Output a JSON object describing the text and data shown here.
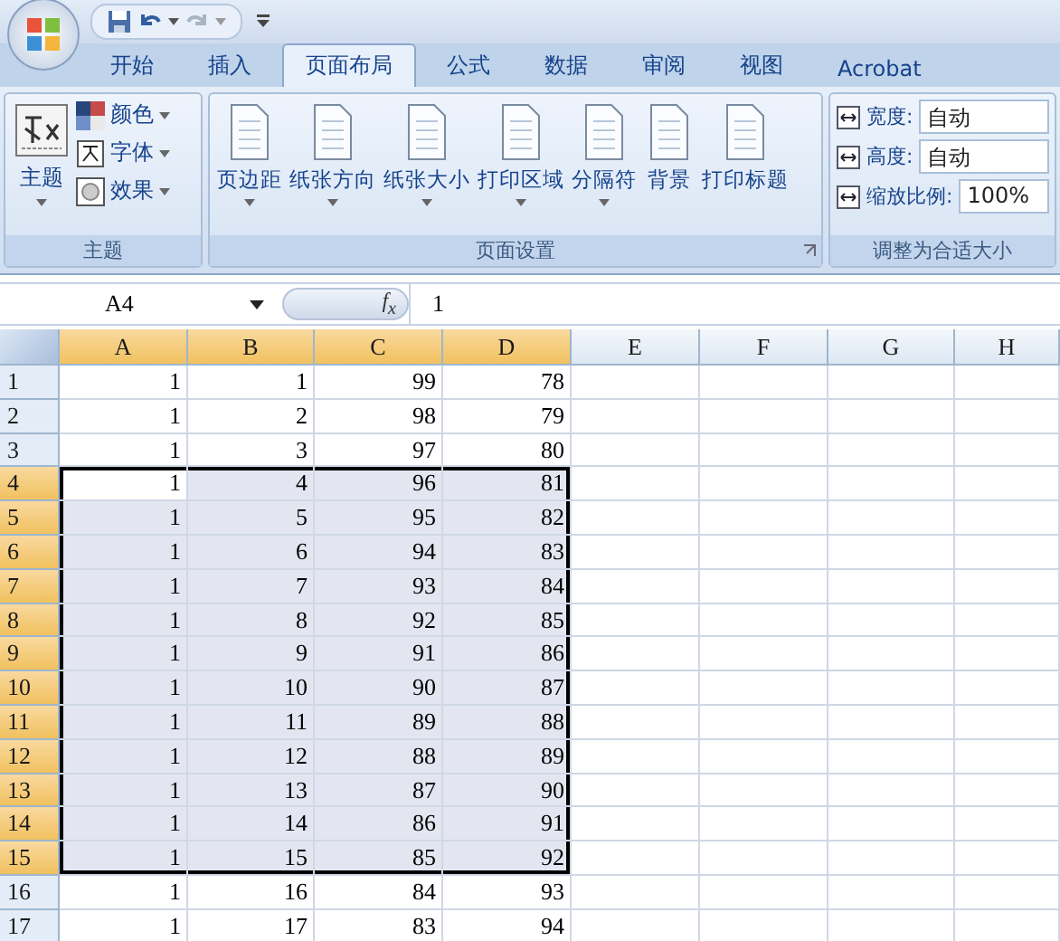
{
  "tabs": [
    {
      "label": "开始",
      "selected": false
    },
    {
      "label": "插入",
      "selected": false
    },
    {
      "label": "页面布局",
      "selected": true
    },
    {
      "label": "公式",
      "selected": false
    },
    {
      "label": "数据",
      "selected": false
    },
    {
      "label": "审阅",
      "selected": false
    },
    {
      "label": "视图",
      "selected": false
    },
    {
      "label": "Acrobat",
      "selected": false
    }
  ],
  "ribbon": {
    "groups": [
      {
        "kind": "theme",
        "label": "主题",
        "large": {
          "label": "主题",
          "dropdown": true
        },
        "small": [
          {
            "label": "颜色",
            "dropdown": true
          },
          {
            "label": "字体",
            "dropdown": true
          },
          {
            "label": "效果",
            "dropdown": true
          }
        ]
      },
      {
        "kind": "buttons",
        "label": "页面设置",
        "launcher": true,
        "buttons": [
          {
            "label": "页边距",
            "dropdown": true
          },
          {
            "label": "纸张方向",
            "dropdown": true
          },
          {
            "label": "纸张大小",
            "dropdown": true
          },
          {
            "label": "打印区域",
            "dropdown": true
          },
          {
            "label": "分隔符",
            "dropdown": true
          },
          {
            "label": "背景",
            "dropdown": false
          },
          {
            "label": "打印标题",
            "dropdown": false
          }
        ]
      },
      {
        "kind": "fields",
        "label": "调整为合适大小",
        "fields": [
          {
            "label": "宽度:",
            "value": "自动"
          },
          {
            "label": "高度:",
            "value": "自动"
          },
          {
            "label": "缩放比例:",
            "value": "100%"
          }
        ]
      }
    ]
  },
  "formula_bar": {
    "name_box": "A4",
    "fx": "f$_{x}$",
    "value": "1"
  },
  "sheet": {
    "columns": [
      {
        "label": "A",
        "selected": true
      },
      {
        "label": "B",
        "selected": true
      },
      {
        "label": "C",
        "selected": true
      },
      {
        "label": "D",
        "selected": true
      },
      {
        "label": "E",
        "selected": false
      },
      {
        "label": "F",
        "selected": false
      },
      {
        "label": "G",
        "selected": false
      },
      {
        "label": "H",
        "selected": false
      }
    ],
    "rows": [
      {
        "label": "1",
        "selected": false,
        "cells": [
          "1",
          "1",
          "99",
          "78"
        ]
      },
      {
        "label": "2",
        "selected": false,
        "cells": [
          "1",
          "2",
          "98",
          "79"
        ]
      },
      {
        "label": "3",
        "selected": false,
        "cells": [
          "1",
          "3",
          "97",
          "80"
        ]
      },
      {
        "label": "4",
        "selected": true,
        "cells": [
          "1",
          "4",
          "96",
          "81"
        ]
      },
      {
        "label": "5",
        "selected": true,
        "cells": [
          "1",
          "5",
          "95",
          "82"
        ]
      },
      {
        "label": "6",
        "selected": true,
        "cells": [
          "1",
          "6",
          "94",
          "83"
        ]
      },
      {
        "label": "7",
        "selected": true,
        "cells": [
          "1",
          "7",
          "93",
          "84"
        ]
      },
      {
        "label": "8",
        "selected": true,
        "cells": [
          "1",
          "8",
          "92",
          "85"
        ]
      },
      {
        "label": "9",
        "selected": true,
        "cells": [
          "1",
          "9",
          "91",
          "86"
        ]
      },
      {
        "label": "10",
        "selected": true,
        "cells": [
          "1",
          "10",
          "90",
          "87"
        ]
      },
      {
        "label": "11",
        "selected": true,
        "cells": [
          "1",
          "11",
          "89",
          "88"
        ]
      },
      {
        "label": "12",
        "selected": true,
        "cells": [
          "1",
          "12",
          "88",
          "89"
        ]
      },
      {
        "label": "13",
        "selected": true,
        "cells": [
          "1",
          "13",
          "87",
          "90"
        ]
      },
      {
        "label": "14",
        "selected": true,
        "cells": [
          "1",
          "14",
          "86",
          "91"
        ]
      },
      {
        "label": "15",
        "selected": true,
        "cells": [
          "1",
          "15",
          "85",
          "92"
        ]
      },
      {
        "label": "16",
        "selected": false,
        "cells": [
          "1",
          "16",
          "84",
          "93"
        ]
      },
      {
        "label": "17",
        "selected": false,
        "cells": [
          "1",
          "17",
          "83",
          "94"
        ]
      }
    ]
  }
}
